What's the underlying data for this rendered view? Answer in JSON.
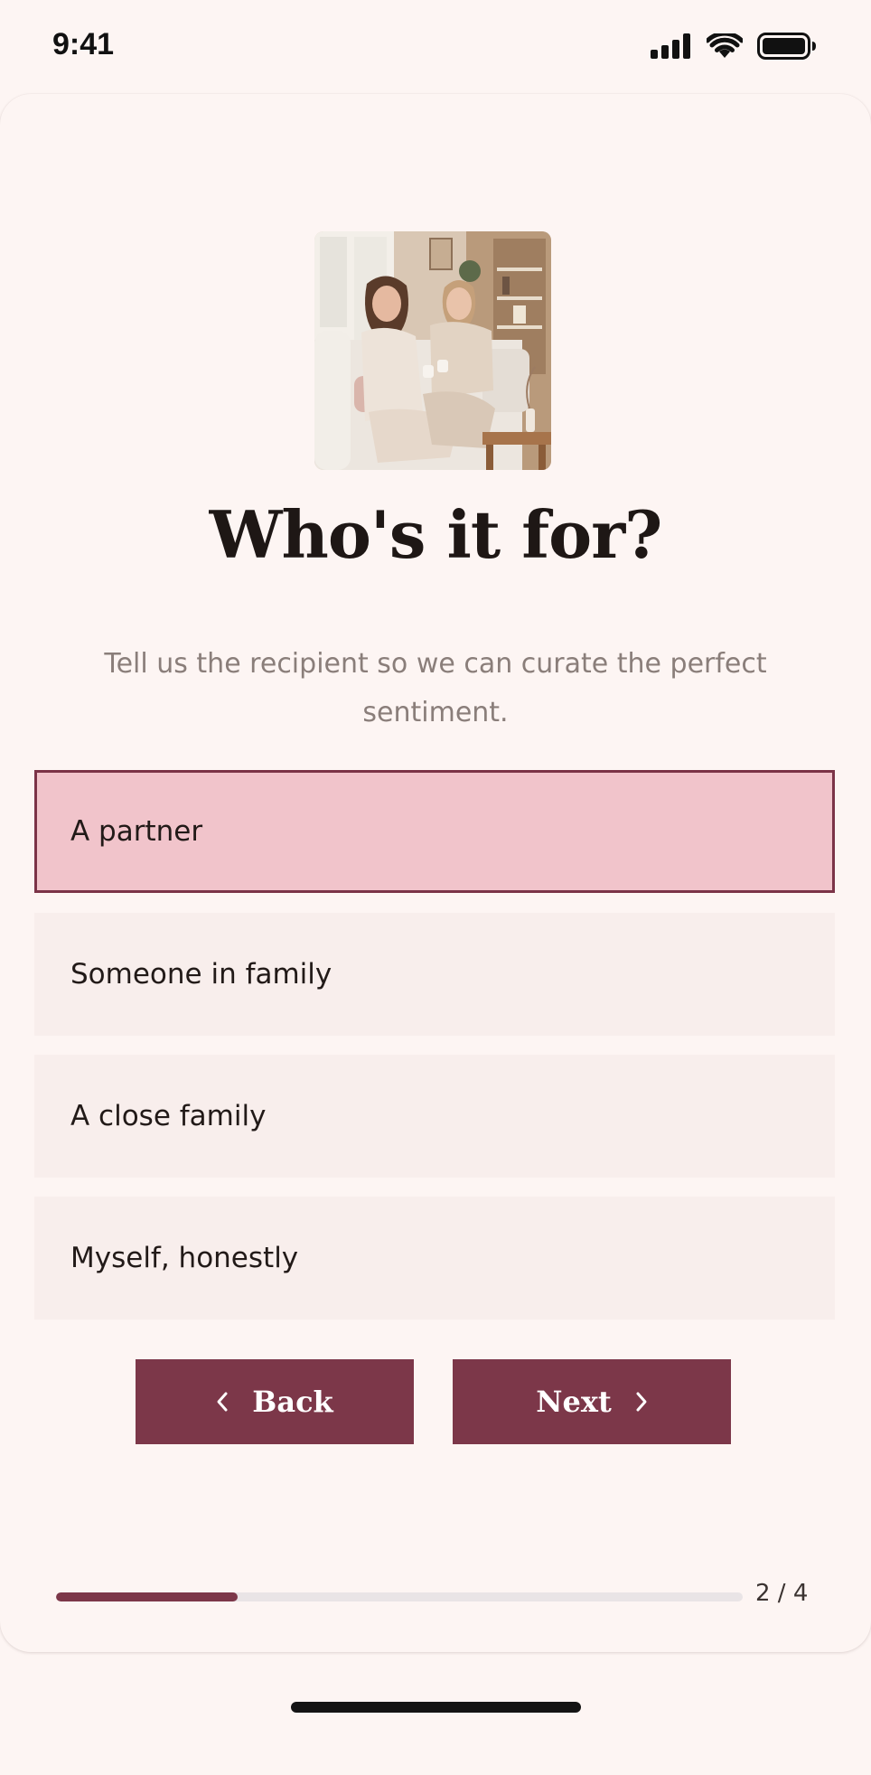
{
  "status_bar": {
    "time": "9:41",
    "icons": [
      "signal-icon",
      "wifi-icon",
      "battery-icon"
    ]
  },
  "hero": {
    "image": "photo of two women laughing on a sofa in a cozy living room"
  },
  "question": {
    "title": "Who's it for?",
    "subtitle": "Tell us the recipient so we can curate the perfect sentiment."
  },
  "options": [
    {
      "label": "A partner",
      "selected": true
    },
    {
      "label": "Someone in family",
      "selected": false
    },
    {
      "label": "A close family",
      "selected": false
    },
    {
      "label": "Myself, honestly",
      "selected": false
    }
  ],
  "navigation": {
    "back_label": "Back",
    "next_label": "Next",
    "back_icon": "chevron-left-icon",
    "next_icon": "chevron-right-icon"
  },
  "progress": {
    "label": "2 / 4",
    "fill_fraction": 0.265
  },
  "colors": {
    "accent": "#7c3749",
    "selected_fill": "#f1c4cb",
    "option_fill": "#f8eeec",
    "background": "#fdf5f3",
    "track": "#e9e4e6"
  }
}
